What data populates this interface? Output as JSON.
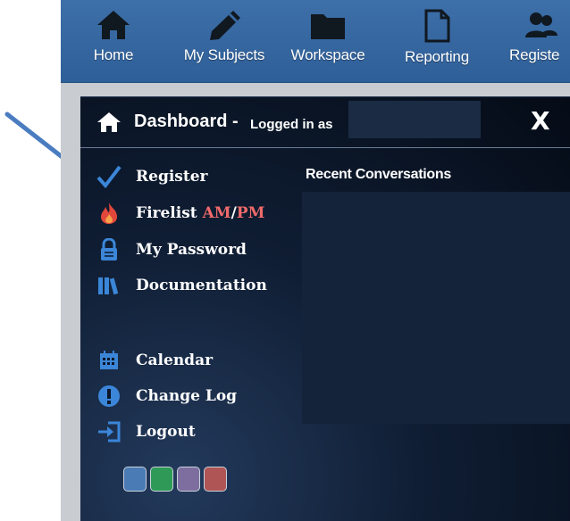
{
  "top_nav": {
    "items": [
      {
        "label": "Home",
        "icon": "home-icon"
      },
      {
        "label": "My Subjects",
        "icon": "pencil-icon"
      },
      {
        "label": "Workspace",
        "icon": "folder-icon"
      },
      {
        "label": "Reporting",
        "icon": "document-icon"
      },
      {
        "label": "Registe",
        "icon": "users-icon"
      }
    ]
  },
  "dashboard": {
    "title": "Dashboard -",
    "subtitle": "Logged in as",
    "close_label": "X"
  },
  "menu": {
    "register": "Register",
    "firelist": "Firelist",
    "am": "AM",
    "slash": "/",
    "pm": "PM",
    "my_password": "My Password",
    "documentation": "Documentation",
    "calendar": "Calendar",
    "change_log": "Change Log",
    "logout": "Logout"
  },
  "recent": {
    "title": "Recent Conversations"
  },
  "theme_swatches": [
    "#4a7bb5",
    "#2f9a57",
    "#7e6ea0",
    "#b05555"
  ],
  "colors": {
    "nav_bg": "#3a6aa3",
    "panel_bg": "#0c1628",
    "accent_red": "#f06a6a",
    "icon_blue": "#3b86d8",
    "annotation_arrow": "#4a7cc0"
  }
}
